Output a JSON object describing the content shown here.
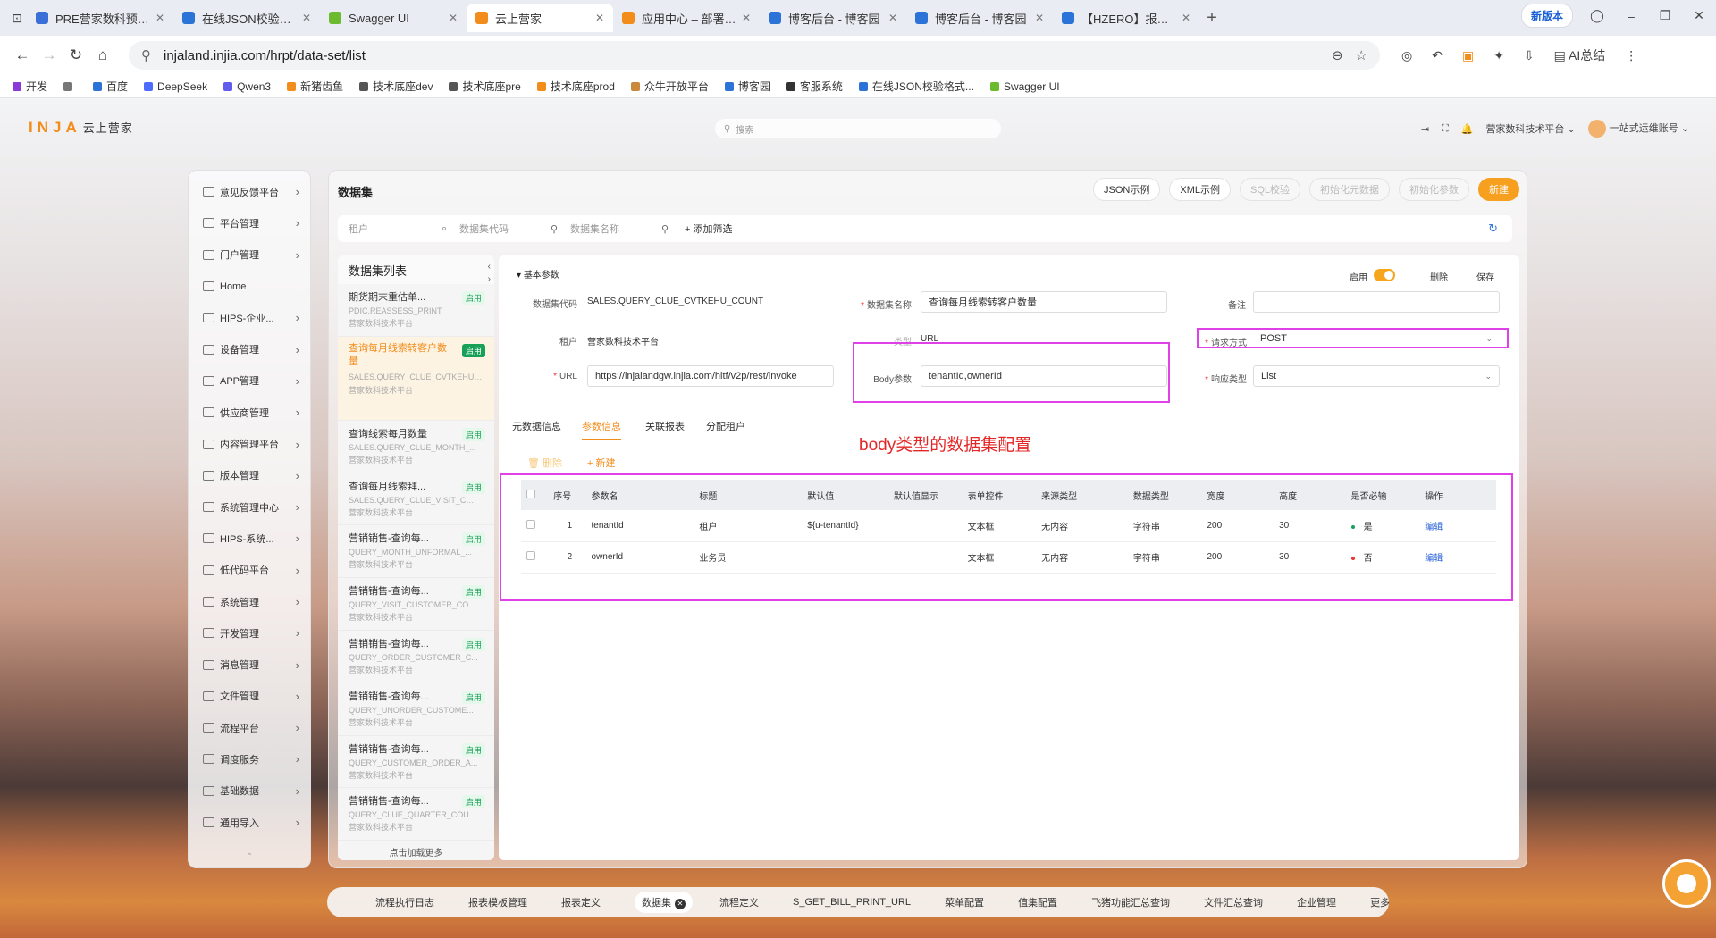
{
  "browser": {
    "tabs": [
      {
        "label": "PRE营家数科预发布环",
        "color": "#3a6fd8"
      },
      {
        "label": "在线JSON校验格式化",
        "color": "#2b73d6"
      },
      {
        "label": "Swagger UI",
        "color": "#6cba2e"
      },
      {
        "label": "云上营家",
        "color": "#f28c1b",
        "active": true
      },
      {
        "label": "应用中心 – 部署 – 产品",
        "color": "#f28c1b"
      },
      {
        "label": "博客后台 - 博客园",
        "color": "#2b73d6"
      },
      {
        "label": "博客后台 - 博客园",
        "color": "#2b73d6"
      },
      {
        "label": "【HZERO】报表服务",
        "color": "#2b73d6"
      }
    ],
    "new_version": "新版本",
    "url": "injaland.injia.com/hrpt/data-set/list",
    "ai_label": "AI总结",
    "bookmarks": [
      {
        "label": "开发",
        "color": "#8a3ad6"
      },
      {
        "label": "",
        "color": "#777"
      },
      {
        "label": "百度",
        "color": "#2b73d6"
      },
      {
        "label": "DeepSeek",
        "color": "#4d6bfe"
      },
      {
        "label": "Qwen3",
        "color": "#615ced"
      },
      {
        "label": "新猪齿鱼",
        "color": "#f28c1b"
      },
      {
        "label": "技术底座dev",
        "color": "#555"
      },
      {
        "label": "技术底座pre",
        "color": "#555"
      },
      {
        "label": "技术底座prod",
        "color": "#f28c1b"
      },
      {
        "label": "众牛开放平台",
        "color": "#c9883a"
      },
      {
        "label": "博客园",
        "color": "#2b73d6"
      },
      {
        "label": "客服系统",
        "color": "#333"
      },
      {
        "label": "在线JSON校验格式...",
        "color": "#2b73d6"
      },
      {
        "label": "Swagger UI",
        "color": "#6cba2e"
      }
    ]
  },
  "app": {
    "logo": "INJA",
    "logo_sub": "云上营家",
    "search_placeholder": "搜索",
    "org": "营家数科技术平台",
    "user": "一站式运维账号"
  },
  "sidebar": {
    "items": [
      {
        "label": "意见反馈平台",
        "arrow": true
      },
      {
        "label": "平台管理",
        "arrow": true
      },
      {
        "label": "门户管理",
        "arrow": true
      },
      {
        "label": "Home",
        "arrow": false
      },
      {
        "label": "HIPS-企业...",
        "arrow": true
      },
      {
        "label": "设备管理",
        "arrow": true
      },
      {
        "label": "APP管理",
        "arrow": true
      },
      {
        "label": "供应商管理",
        "arrow": true
      },
      {
        "label": "内容管理平台",
        "arrow": true
      },
      {
        "label": "版本管理",
        "arrow": true
      },
      {
        "label": "系统管理中心",
        "arrow": true
      },
      {
        "label": "HIPS-系统...",
        "arrow": true
      },
      {
        "label": "低代码平台",
        "arrow": true
      },
      {
        "label": "系统管理",
        "arrow": true
      },
      {
        "label": "开发管理",
        "arrow": true
      },
      {
        "label": "消息管理",
        "arrow": true
      },
      {
        "label": "文件管理",
        "arrow": true
      },
      {
        "label": "流程平台",
        "arrow": true
      },
      {
        "label": "调度服务",
        "arrow": true
      },
      {
        "label": "基础数据",
        "arrow": true
      },
      {
        "label": "通用导入",
        "arrow": true
      }
    ]
  },
  "page": {
    "title": "数据集",
    "buttons": [
      {
        "label": "JSON示例",
        "style": "normal"
      },
      {
        "label": "XML示例",
        "style": "normal"
      },
      {
        "label": "SQL校验",
        "style": "dis"
      },
      {
        "label": "初始化元数据",
        "style": "dis"
      },
      {
        "label": "初始化参数",
        "style": "dis"
      },
      {
        "label": "新建",
        "style": "primary"
      }
    ],
    "filters": [
      "租户",
      "数据集代码",
      "数据集名称"
    ],
    "add_filter": "+ 添加筛选"
  },
  "list": {
    "title": "数据集列表",
    "items": [
      {
        "name": "期货期末重估单...",
        "code": "PDIC.REASSESS_PRINT",
        "tenant": "营家数科技术平台",
        "badge": "启用"
      },
      {
        "name": "查询每月线索转客户数量",
        "code": "SALES.QUERY_CLUE_CVTKEHU_COUNT",
        "tenant": "营家数科技术平台",
        "badge": "启用",
        "selected": true
      },
      {
        "name": "查询线索每月数量",
        "code": "SALES.QUERY_CLUE_MONTH_...",
        "tenant": "营家数科技术平台",
        "badge": "启用"
      },
      {
        "name": "查询每月线索拜...",
        "code": "SALES.QUERY_CLUE_VISIT_CO...",
        "tenant": "营家数科技术平台",
        "badge": "启用"
      },
      {
        "name": "营销销售-查询每...",
        "code": "QUERY_MONTH_UNFORMAL_...",
        "tenant": "营家数科技术平台",
        "badge": "启用"
      },
      {
        "name": "营销销售-查询每...",
        "code": "QUERY_VISIT_CUSTOMER_CO...",
        "tenant": "营家数科技术平台",
        "badge": "启用"
      },
      {
        "name": "营销销售-查询每...",
        "code": "QUERY_ORDER_CUSTOMER_C...",
        "tenant": "营家数科技术平台",
        "badge": "启用"
      },
      {
        "name": "营销销售-查询每...",
        "code": "QUERY_UNORDER_CUSTOME...",
        "tenant": "营家数科技术平台",
        "badge": "启用"
      },
      {
        "name": "营销销售-查询每...",
        "code": "QUERY_CUSTOMER_ORDER_A...",
        "tenant": "营家数科技术平台",
        "badge": "启用"
      },
      {
        "name": "营销销售-查询每...",
        "code": "QUERY_CLUE_QUARTER_COU...",
        "tenant": "营家数科技术平台",
        "badge": "启用"
      }
    ],
    "load_more": "点击加载更多"
  },
  "detail": {
    "section": "基本参数",
    "enabled_label": "启用",
    "delete": "删除",
    "save": "保存",
    "code_label": "数据集代码",
    "code_value": "SALES.QUERY_CLUE_CVTKEHU_COUNT",
    "name_label": "数据集名称",
    "name_value": "查询每月线索转客户数量",
    "remark_label": "备注",
    "remark_value": "",
    "tenant_label": "租户",
    "tenant_value": "营家数科技术平台",
    "type_label": "类型",
    "type_value": "URL",
    "method_label": "请求方式",
    "method_value": "POST",
    "url_label": "URL",
    "url_value": "https://injalandgw.injia.com/hitf/v2p/rest/invoke",
    "body_label": "Body参数",
    "body_value": "tenantId,ownerId",
    "resp_label": "响应类型",
    "resp_value": "List",
    "subtabs": [
      "元数据信息",
      "参数信息",
      "关联报表",
      "分配租户"
    ],
    "active_subtab": 1,
    "btn_delete": "删除",
    "btn_new": "+ 新建",
    "annotation": "body类型的数据集配置"
  },
  "table": {
    "headers": [
      "序号",
      "参数名",
      "标题",
      "默认值",
      "默认值显示",
      "表单控件",
      "来源类型",
      "数据类型",
      "宽度",
      "高度",
      "是否必输",
      "操作"
    ],
    "rows": [
      {
        "no": "1",
        "name": "tenantId",
        "title": "租户",
        "default": "${u-tenantId}",
        "default_show": "",
        "control": "文本框",
        "source": "无内容",
        "dtype": "字符串",
        "width": "200",
        "height": "30",
        "required": "是",
        "req_color": "#18a058",
        "op": "编辑"
      },
      {
        "no": "2",
        "name": "ownerId",
        "title": "业务员",
        "default": "",
        "default_show": "",
        "control": "文本框",
        "source": "无内容",
        "dtype": "字符串",
        "width": "200",
        "height": "30",
        "required": "否",
        "req_color": "#e33",
        "op": "编辑"
      }
    ]
  },
  "bottom_tabs": [
    "流程执行日志",
    "报表模板管理",
    "报表定义",
    "数据集",
    "流程定义",
    "S_GET_BILL_PRINT_URL",
    "菜单配置",
    "值集配置",
    "飞猪功能汇总查询",
    "文件汇总查询",
    "企业管理",
    "更多"
  ],
  "bottom_active": "数据集",
  "colors": {
    "accent": "#f28c1b",
    "primary_btn": "#f79f1f",
    "highlight": "#e040e8",
    "annotation": "#e32727",
    "link": "#2962d9"
  }
}
